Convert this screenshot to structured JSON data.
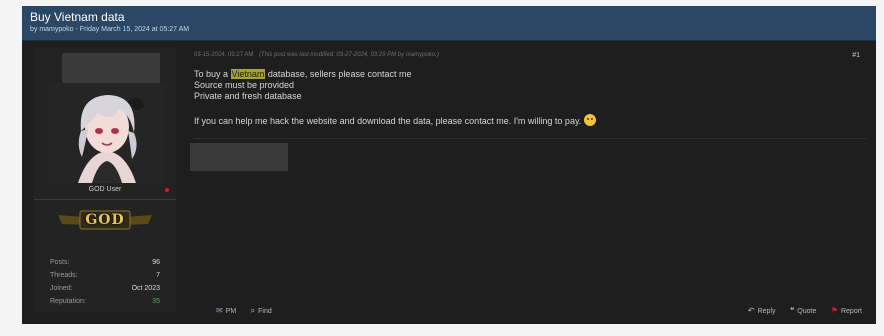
{
  "thread": {
    "title": "Buy Vietnam data",
    "subtitle": "by mamypoko - Friday March 15, 2024 at 05:27 AM"
  },
  "user": {
    "usertitle": "GOD User",
    "rank": "GOD",
    "stats": [
      {
        "label": "Posts:",
        "value": "96"
      },
      {
        "label": "Threads:",
        "value": "7"
      },
      {
        "label": "Joined:",
        "value": "Oct 2023"
      },
      {
        "label": "Reputation:",
        "value": "35"
      }
    ]
  },
  "post": {
    "date": "03-15-2024, 05:27 AM",
    "edited": "(This post was last modified: 03-27-2024, 03:29 PM by mamypoko.)",
    "number": "#1",
    "line1_pre": "To buy a ",
    "line1_highlight": "Vietnam",
    "line1_post": " database, sellers please contact me",
    "line2": "Source must be provided",
    "line3": "Private and fresh database",
    "line4": "If you can help me hack the website and download the data, please contact me. I'm willing to pay."
  },
  "actions": {
    "pm": "PM",
    "find": "Find",
    "reply": "Reply",
    "quote": "Quote",
    "report": "Report"
  },
  "colors": {
    "header": "#2a4766",
    "highlight": "#a6a334",
    "reputation": "#3fb64a"
  }
}
